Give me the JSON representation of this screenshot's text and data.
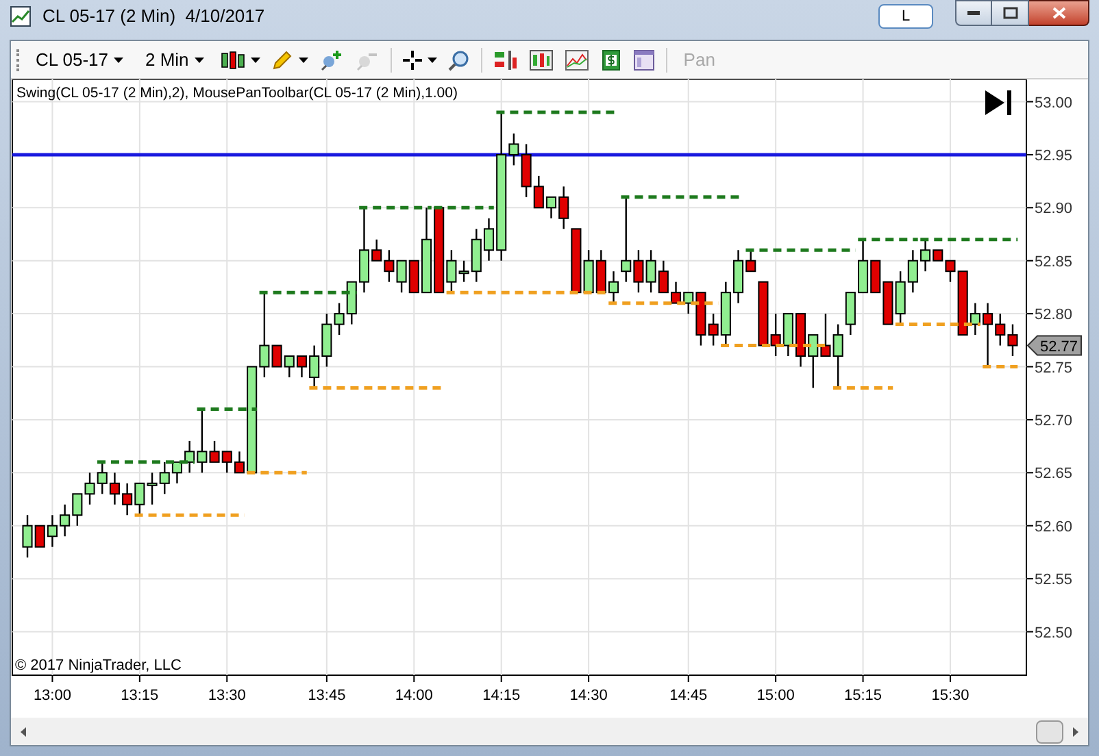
{
  "window": {
    "title": "CL 05-17 (2 Min)  4/10/2017",
    "buttons": [
      "L"
    ]
  },
  "toolbar": {
    "instrument": "CL 05-17",
    "interval": "2 Min",
    "pan": {
      "label": "Pan",
      "disabled": true
    }
  },
  "chart": {
    "indicator_label": "Swing(CL 05-17 (2 Min),2), MousePanToolbar(CL 05-17 (2 Min),1.00)",
    "copyright": "© 2017 NinjaTrader, LLC",
    "last_price": "52.77",
    "chart_data": {
      "type": "candlestick",
      "ylim": [
        52.459,
        53.021
      ],
      "categories": [
        null,
        null,
        "13:00",
        null,
        null,
        null,
        null,
        null,
        null,
        "13:15",
        null,
        null,
        null,
        null,
        null,
        null,
        "13:30",
        null,
        null,
        null,
        null,
        null,
        null,
        null,
        "13:45",
        null,
        null,
        null,
        null,
        null,
        null,
        "14:00",
        null,
        null,
        null,
        null,
        null,
        null,
        "14:15",
        null,
        null,
        null,
        null,
        null,
        null,
        "14:30",
        null,
        null,
        null,
        null,
        null,
        null,
        null,
        "14:45",
        null,
        null,
        null,
        null,
        null,
        null,
        "15:00",
        null,
        null,
        null,
        null,
        null,
        null,
        "15:15",
        null,
        null,
        null,
        null,
        null,
        null,
        "15:30",
        null,
        null,
        null,
        null,
        null
      ],
      "yticks": [
        {
          "value": 53,
          "label": "53.00"
        },
        {
          "value": 52.95,
          "label": "52.95"
        },
        {
          "value": 52.9,
          "label": "52.90"
        },
        {
          "value": 52.85,
          "label": "52.85"
        },
        {
          "value": 52.8,
          "label": "52.80"
        },
        {
          "value": 52.75,
          "label": "52.75"
        },
        {
          "value": 52.7,
          "label": "52.70"
        },
        {
          "value": 52.65,
          "label": "52.65"
        },
        {
          "value": 52.6,
          "label": "52.60"
        },
        {
          "value": 52.55,
          "label": "52.55"
        },
        {
          "value": 52.5,
          "label": "52.50"
        }
      ],
      "ohlc": [
        [
          52.58,
          52.61,
          52.57,
          52.6
        ],
        [
          52.6,
          52.6,
          52.58,
          52.58
        ],
        [
          52.59,
          52.61,
          52.58,
          52.6
        ],
        [
          52.6,
          52.62,
          52.59,
          52.61
        ],
        [
          52.61,
          52.63,
          52.6,
          52.63
        ],
        [
          52.63,
          52.65,
          52.62,
          52.64
        ],
        [
          52.64,
          52.66,
          52.63,
          52.65
        ],
        [
          52.64,
          52.65,
          52.62,
          52.63
        ],
        [
          52.63,
          52.64,
          52.61,
          52.62
        ],
        [
          52.62,
          52.64,
          52.61,
          52.64
        ],
        [
          52.64,
          52.65,
          52.62,
          52.64
        ],
        [
          52.64,
          52.66,
          52.63,
          52.65
        ],
        [
          52.65,
          52.66,
          52.64,
          52.66
        ],
        [
          52.66,
          52.68,
          52.65,
          52.67
        ],
        [
          52.66,
          52.71,
          52.65,
          52.67
        ],
        [
          52.67,
          52.68,
          52.66,
          52.66
        ],
        [
          52.67,
          52.67,
          52.65,
          52.66
        ],
        [
          52.66,
          52.67,
          52.65,
          52.65
        ],
        [
          52.65,
          52.75,
          52.65,
          52.75
        ],
        [
          52.75,
          52.82,
          52.74,
          52.77
        ],
        [
          52.77,
          52.77,
          52.75,
          52.75
        ],
        [
          52.75,
          52.76,
          52.74,
          52.76
        ],
        [
          52.76,
          52.76,
          52.74,
          52.75
        ],
        [
          52.74,
          52.77,
          52.73,
          52.76
        ],
        [
          52.76,
          52.8,
          52.75,
          52.79
        ],
        [
          52.79,
          52.81,
          52.78,
          52.8
        ],
        [
          52.8,
          52.83,
          52.79,
          52.83
        ],
        [
          52.83,
          52.9,
          52.82,
          52.86
        ],
        [
          52.86,
          52.87,
          52.85,
          52.85
        ],
        [
          52.85,
          52.86,
          52.83,
          52.84
        ],
        [
          52.83,
          52.85,
          52.82,
          52.85
        ],
        [
          52.85,
          52.85,
          52.82,
          52.82
        ],
        [
          52.82,
          52.9,
          52.82,
          52.87
        ],
        [
          52.9,
          52.9,
          52.82,
          52.82
        ],
        [
          52.83,
          52.86,
          52.82,
          52.85
        ],
        [
          52.84,
          52.85,
          52.83,
          52.84
        ],
        [
          52.84,
          52.88,
          52.83,
          52.87
        ],
        [
          52.86,
          52.89,
          52.85,
          52.88
        ],
        [
          52.86,
          52.99,
          52.85,
          52.95
        ],
        [
          52.95,
          52.97,
          52.94,
          52.96
        ],
        [
          52.95,
          52.96,
          52.91,
          52.92
        ],
        [
          52.92,
          52.93,
          52.9,
          52.9
        ],
        [
          52.9,
          52.91,
          52.89,
          52.91
        ],
        [
          52.91,
          52.92,
          52.88,
          52.89
        ],
        [
          52.88,
          52.88,
          52.82,
          52.82
        ],
        [
          52.82,
          52.86,
          52.82,
          52.85
        ],
        [
          52.85,
          52.86,
          52.82,
          52.82
        ],
        [
          52.82,
          52.84,
          52.81,
          52.83
        ],
        [
          52.84,
          52.91,
          52.83,
          52.85
        ],
        [
          52.85,
          52.86,
          52.82,
          52.83
        ],
        [
          52.83,
          52.86,
          52.82,
          52.85
        ],
        [
          52.84,
          52.85,
          52.82,
          52.82
        ],
        [
          52.82,
          52.83,
          52.81,
          52.81
        ],
        [
          52.81,
          52.82,
          52.8,
          52.82
        ],
        [
          52.82,
          52.82,
          52.77,
          52.78
        ],
        [
          52.79,
          52.8,
          52.77,
          52.78
        ],
        [
          52.78,
          52.83,
          52.77,
          52.82
        ],
        [
          52.82,
          52.86,
          52.81,
          52.85
        ],
        [
          52.85,
          52.86,
          52.84,
          52.84
        ],
        [
          52.83,
          52.83,
          52.77,
          52.77
        ],
        [
          52.78,
          52.8,
          52.76,
          52.77
        ],
        [
          52.77,
          52.8,
          52.76,
          52.8
        ],
        [
          52.8,
          52.8,
          52.75,
          52.76
        ],
        [
          52.76,
          52.78,
          52.73,
          52.78
        ],
        [
          52.77,
          52.8,
          52.76,
          52.76
        ],
        [
          52.76,
          52.79,
          52.73,
          52.78
        ],
        [
          52.79,
          52.82,
          52.78,
          52.82
        ],
        [
          52.82,
          52.87,
          52.82,
          52.85
        ],
        [
          52.85,
          52.85,
          52.82,
          52.82
        ],
        [
          52.83,
          52.83,
          52.79,
          52.79
        ],
        [
          52.8,
          52.84,
          52.79,
          52.83
        ],
        [
          52.83,
          52.86,
          52.82,
          52.85
        ],
        [
          52.85,
          52.87,
          52.84,
          52.86
        ],
        [
          52.86,
          52.86,
          52.85,
          52.85
        ],
        [
          52.85,
          52.85,
          52.83,
          52.84
        ],
        [
          52.84,
          52.84,
          52.78,
          52.78
        ],
        [
          52.79,
          52.81,
          52.78,
          52.8
        ],
        [
          52.8,
          52.81,
          52.75,
          52.79
        ],
        [
          52.79,
          52.8,
          52.77,
          52.78
        ],
        [
          52.78,
          52.79,
          52.76,
          52.77
        ]
      ],
      "grid": true,
      "ref_lines": [
        {
          "axis": "y",
          "value": 52.95,
          "color": "#1a1adf"
        }
      ]
    }
  }
}
